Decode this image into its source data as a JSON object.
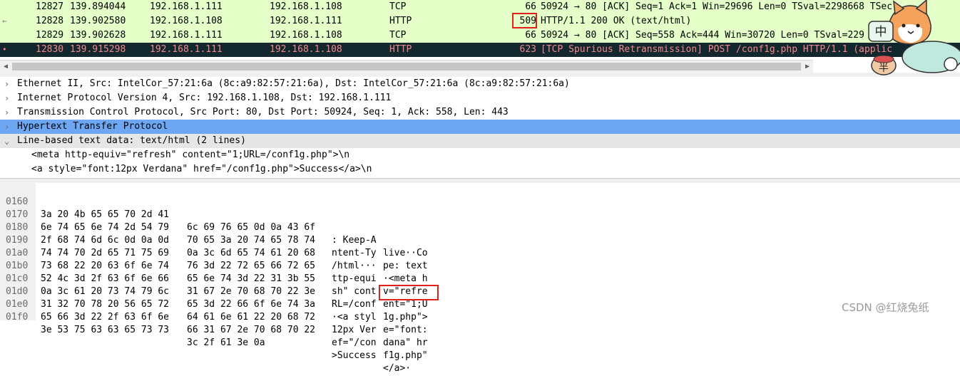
{
  "packets": [
    {
      "no": "12827",
      "time": "139.894044",
      "src": "192.168.1.111",
      "dst": "192.168.1.108",
      "proto": "TCP",
      "len": "66",
      "info": "50924 → 80 [ACK] Seq=1 Ack=1 Win=29696 Len=0 TSval=2298668 TSec",
      "marker": ""
    },
    {
      "no": "12828",
      "time": "139.902580",
      "src": "192.168.1.108",
      "dst": "192.168.1.111",
      "proto": "HTTP",
      "len": "509",
      "info": "HTTP/1.1 200 OK  (text/html)",
      "marker": "←"
    },
    {
      "no": "12829",
      "time": "139.902628",
      "src": "192.168.1.111",
      "dst": "192.168.1.108",
      "proto": "TCP",
      "len": "66",
      "info": "50924 → 80 [ACK] Seq=558 Ack=444 Win=30720 Len=0 TSval=229",
      "marker": ""
    },
    {
      "no": "12830",
      "time": "139.915298",
      "src": "192.168.1.111",
      "dst": "192.168.1.108",
      "proto": "HTTP",
      "len": "623",
      "info": "[TCP Spurious Retransmission] POST /conf1g.php HTTP/1.1  (applic",
      "marker": "•"
    }
  ],
  "details": [
    {
      "arrow": "›",
      "label": "Ethernet II, Src: IntelCor_57:21:6a (8c:a9:82:57:21:6a), Dst: IntelCor_57:21:6a (8c:a9:82:57:21:6a)"
    },
    {
      "arrow": "›",
      "label": "Internet Protocol Version 4, Src: 192.168.1.108, Dst: 192.168.1.111"
    },
    {
      "arrow": "›",
      "label": "Transmission Control Protocol, Src Port: 80, Dst Port: 50924, Seq: 1, Ack: 558, Len: 443"
    },
    {
      "arrow": "›",
      "label": "Hypertext Transfer Protocol"
    },
    {
      "arrow": "⌄",
      "label": "Line-based text data: text/html (2 lines)"
    },
    {
      "arrow": "",
      "label": "<meta http-equiv=\"refresh\" content=\"1;URL=/conf1g.php\">\\n"
    },
    {
      "arrow": "",
      "label": "<a style=\"font:12px Verdana\" href=\"/conf1g.php\">Success</a>\\n"
    }
  ],
  "hex": [
    {
      "off": "0160",
      "b1": "3a 20 4b 65 65 70 2d 41",
      "b2": "6c 69 76 65 0d 0a 43 6f",
      "a1": ": Keep-A",
      "a2": "live··Co"
    },
    {
      "off": "0170",
      "b1": "6e 74 65 6e 74 2d 54 79",
      "b2": "70 65 3a 20 74 65 78 74",
      "a1": "ntent-Ty",
      "a2": "pe: text"
    },
    {
      "off": "0180",
      "b1": "2f 68 74 6d 6c 0d 0a 0d",
      "b2": "0a 3c 6d 65 74 61 20 68",
      "a1": "/html···",
      "a2": "·<meta h"
    },
    {
      "off": "0190",
      "b1": "74 74 70 2d 65 71 75 69",
      "b2": "76 3d 22 72 65 66 72 65",
      "a1": "ttp-equi",
      "a2": "v=\"refre"
    },
    {
      "off": "01a0",
      "b1": "73 68 22 20 63 6f 6e 74",
      "b2": "65 6e 74 3d 22 31 3b 55",
      "a1": "sh\" cont",
      "a2": "ent=\"1;U"
    },
    {
      "off": "01b0",
      "b1": "52 4c 3d 2f 63 6f 6e 66",
      "b2": "31 67 2e 70 68 70 22 3e",
      "a1": "RL=/conf",
      "a2": "1g.php\">"
    },
    {
      "off": "01c0",
      "b1": "0a 3c 61 20 73 74 79 6c",
      "b2": "65 3d 22 66 6f 6e 74 3a",
      "a1": "·<a styl",
      "a2": "e=\"font:"
    },
    {
      "off": "01d0",
      "b1": "31 32 70 78 20 56 65 72",
      "b2": "64 61 6e 61 22 20 68 72",
      "a1": "12px Ver",
      "a2": "dana\" hr"
    },
    {
      "off": "01e0",
      "b1": "65 66 3d 22 2f 63 6f 6e",
      "b2": "66 31 67 2e 70 68 70 22",
      "a1": "ef=\"/con",
      "a2": "f1g.php\""
    },
    {
      "off": "01f0",
      "b1": "3e 53 75 63 63 65 73 73",
      "b2": "3c 2f 61 3e 0a",
      "a1": ">Success",
      "a2": "</a>·"
    }
  ],
  "watermark": "CSDN @红烧兔纸",
  "sticker": {
    "chars": [
      "中",
      "半"
    ]
  },
  "icons": {
    "marker_arrow": "left-arrow-icon",
    "tree_arrow": "chevron-right-icon"
  },
  "colors": {
    "row_http_bg": "#e4ffc7",
    "row_tcp_bg": "#e4ffc7",
    "row_selected_bg": "#12272e",
    "row_selected_fg": "#f78787",
    "tree_selected": "#6da7f3",
    "highlight_box": "#e0201b"
  }
}
